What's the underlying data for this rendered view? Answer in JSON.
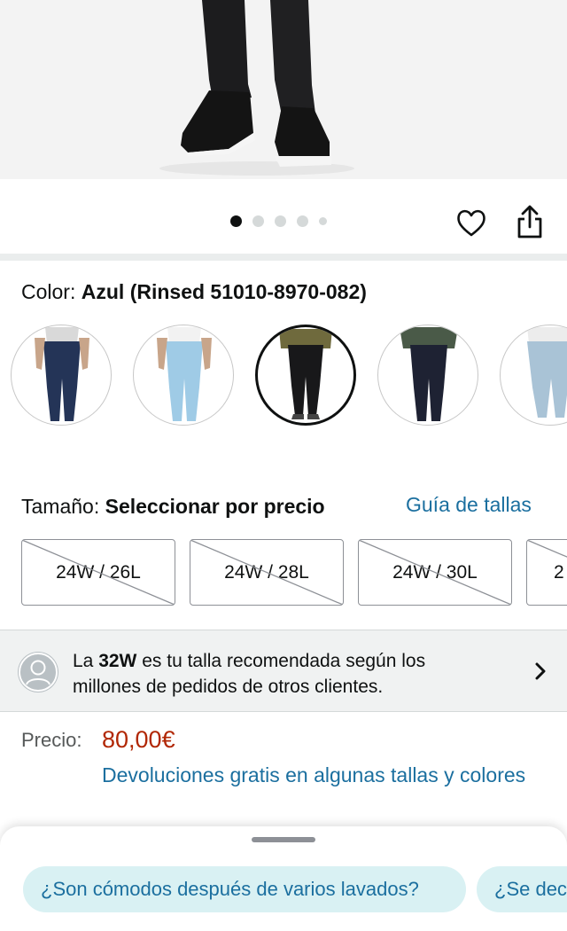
{
  "product": {
    "color_label": "Color:",
    "color_value": "Azul (Rinsed 51010-8970-082)",
    "size_label": "Tamaño:",
    "size_value": "Seleccionar por precio",
    "size_guide_link": "Guía de tallas"
  },
  "carousel": {
    "total_dots": 5,
    "active_index": 0,
    "icons": [
      "heart-icon",
      "share-icon"
    ]
  },
  "color_swatches": [
    {
      "name": "dark-blue-jeans",
      "selected": false
    },
    {
      "name": "light-blue-jeans",
      "selected": false
    },
    {
      "name": "black-jeans",
      "selected": true
    },
    {
      "name": "navy-jeans",
      "selected": false
    },
    {
      "name": "faded-light-jeans",
      "selected": false
    }
  ],
  "sizes": [
    {
      "label": "24W / 26L",
      "available": false
    },
    {
      "label": "24W / 28L",
      "available": false
    },
    {
      "label": "24W / 30L",
      "available": false
    },
    {
      "label": "2",
      "available": false
    }
  ],
  "recommendation": {
    "prefix": "La ",
    "size": "32W",
    "suffix": " es tu talla recomendada según los millones de pedidos de otros clientes."
  },
  "price": {
    "label": "Precio:",
    "value": "80,00€",
    "returns": "Devoluciones gratis en algunas tallas y colores"
  },
  "questions": [
    "¿Son cómodos después de varios lavados?",
    "¿Se deco"
  ],
  "colors": {
    "link": "#1b6f9f",
    "price": "#b12704",
    "chip_bg": "#d9f1f3",
    "banner_bg": "#f0f2f2"
  }
}
